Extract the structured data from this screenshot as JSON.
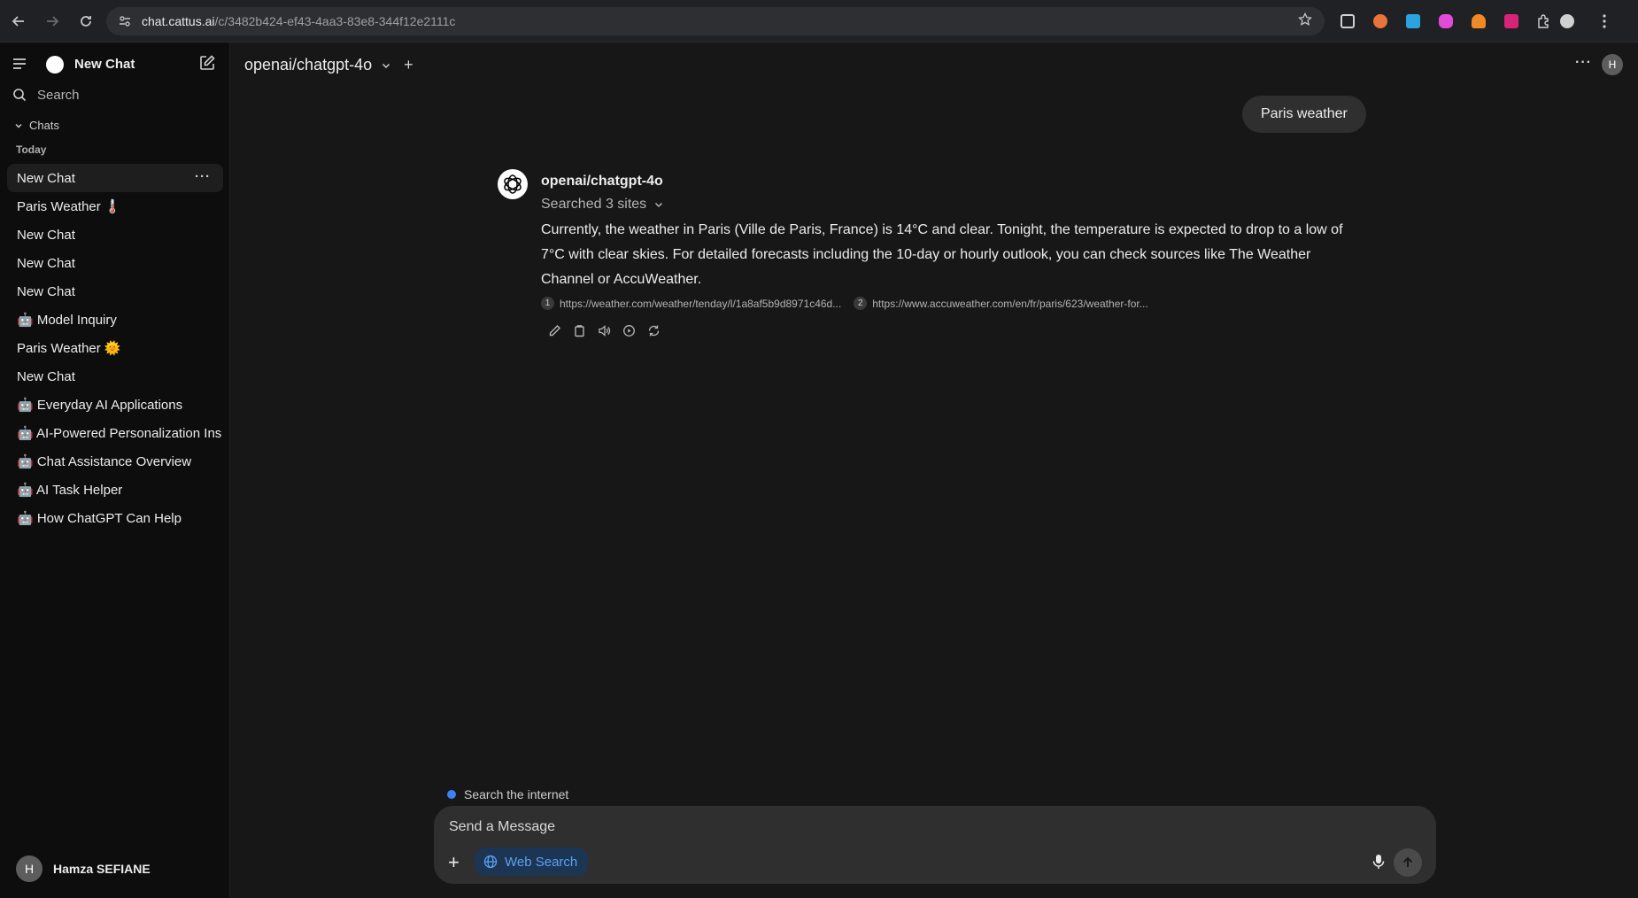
{
  "browser": {
    "url_domain": "chat.cattus.ai",
    "url_path": "/c/3482b424-ef43-4aa3-83e8-344f12e2111c"
  },
  "sidebar": {
    "title": "New Chat",
    "search_placeholder": "Search",
    "section_label": "Chats",
    "group_label": "Today",
    "items": [
      {
        "label": "New Chat"
      },
      {
        "label": "Paris Weather 🌡️"
      },
      {
        "label": "New Chat"
      },
      {
        "label": "New Chat"
      },
      {
        "label": "New Chat"
      },
      {
        "label": "🤖 Model Inquiry"
      },
      {
        "label": "Paris Weather 🌞"
      },
      {
        "label": "New Chat"
      },
      {
        "label": "🤖 Everyday AI Applications"
      },
      {
        "label": "🤖 AI-Powered Personalization Ins"
      },
      {
        "label": "🤖 Chat Assistance Overview"
      },
      {
        "label": "🤖 AI Task Helper"
      },
      {
        "label": "🤖 How ChatGPT Can Help"
      }
    ],
    "user": {
      "initial": "H",
      "name": "Hamza SEFIANE"
    }
  },
  "header": {
    "model": "openai/chatgpt-4o",
    "plus": "+",
    "avatar_initial": "H"
  },
  "conversation": {
    "user_message": "Paris weather",
    "assistant_name": "openai/chatgpt-4o",
    "searched_label": "Searched 3 sites",
    "answer": "Currently, the weather in Paris (Ville de Paris, France) is 14°C and clear. Tonight, the temperature is expected to drop to a low of 7°C with clear skies. For detailed forecasts including the 10-day or hourly outlook, you can check sources like The Weather Channel or AccuWeather.",
    "sources": [
      {
        "num": "1",
        "url": "https://weather.com/weather/tenday/l/1a8af5b9d8971c46d..."
      },
      {
        "num": "2",
        "url": "https://www.accuweather.com/en/fr/paris/623/weather-for..."
      }
    ]
  },
  "composer": {
    "search_indicator": "Search the internet",
    "placeholder": "Send a Message",
    "web_search_label": "Web Search"
  },
  "colors": {
    "background": "#171717",
    "sidebar": "#0d0d0d",
    "composer": "#2f2f2f",
    "accent_blue": "#3b82f6"
  }
}
